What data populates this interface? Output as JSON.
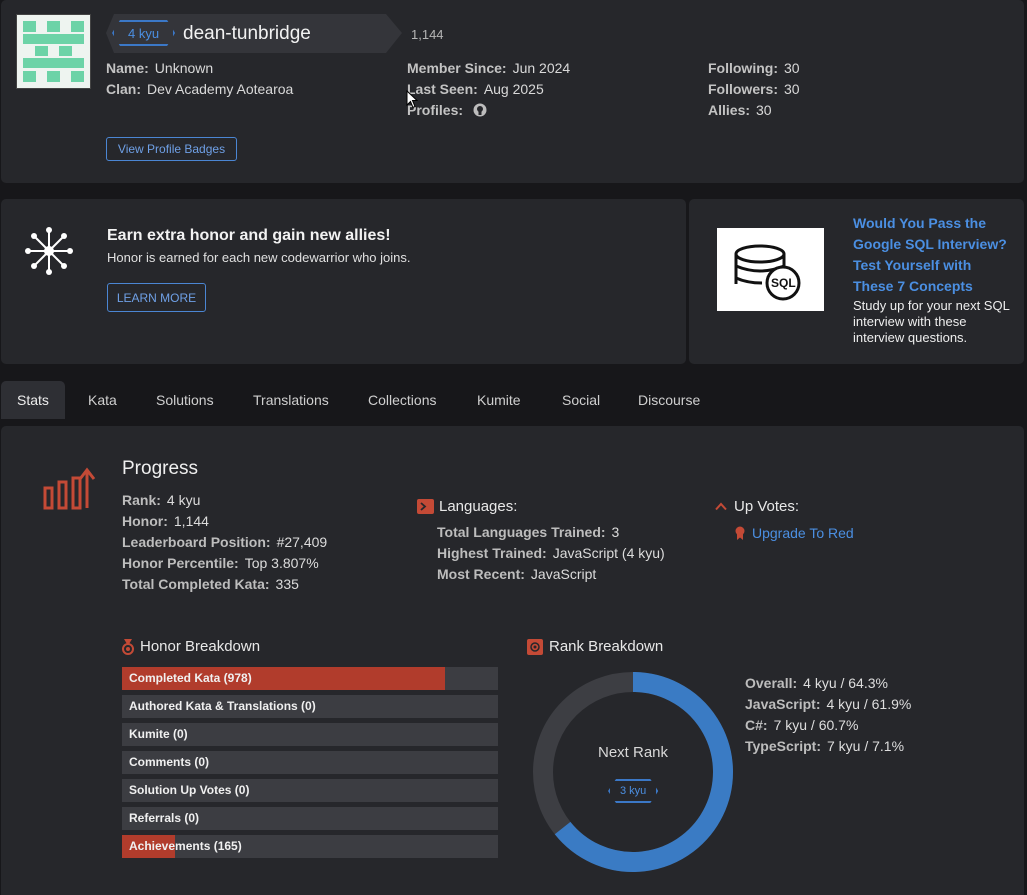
{
  "profile": {
    "rank": "4 kyu",
    "username": "dean-tunbridge",
    "honor": "1,144",
    "name_label": "Name:",
    "name": "Unknown",
    "clan_label": "Clan:",
    "clan": "Dev Academy Aotearoa",
    "member_since_label": "Member Since:",
    "member_since": "Jun 2024",
    "last_seen_label": "Last Seen:",
    "last_seen": "Aug 2025",
    "profiles_label": "Profiles:",
    "following_label": "Following:",
    "following": "30",
    "followers_label": "Followers:",
    "followers": "30",
    "allies_label": "Allies:",
    "allies": "30",
    "badges_button": "View Profile Badges"
  },
  "banner": {
    "title": "Earn extra honor and gain new allies!",
    "subtitle": "Honor is earned for each new codewarrior who joins.",
    "button": "LEARN MORE"
  },
  "ad": {
    "image_text": "SQL",
    "title": "Would You Pass the Google SQL Interview? Test Yourself with These 7 Concepts",
    "text": "Study up for your next SQL interview with these interview questions."
  },
  "tabs": [
    "Stats",
    "Kata",
    "Solutions",
    "Translations",
    "Collections",
    "Kumite",
    "Social",
    "Discourse"
  ],
  "progress": {
    "title": "Progress",
    "rank_label": "Rank:",
    "rank": "4 kyu",
    "honor_label": "Honor:",
    "honor": "1,144",
    "leaderboard_label": "Leaderboard Position:",
    "leaderboard": "#27,409",
    "percentile_label": "Honor Percentile:",
    "percentile": "Top 3.807%",
    "completed_label": "Total Completed Kata:",
    "completed": "335"
  },
  "languages": {
    "title": "Languages:",
    "trained_label": "Total Languages Trained:",
    "trained": "3",
    "highest_label": "Highest Trained:",
    "highest": "JavaScript (4 kyu)",
    "recent_label": "Most Recent:",
    "recent": "JavaScript"
  },
  "upvotes": {
    "title": "Up Votes:",
    "link": "Upgrade To Red"
  },
  "honor_breakdown": {
    "title": "Honor Breakdown",
    "rows": [
      {
        "label": "Completed Kata (978)",
        "fill": 0.86
      },
      {
        "label": "Authored Kata & Translations (0)",
        "fill": 0
      },
      {
        "label": "Kumite (0)",
        "fill": 0
      },
      {
        "label": "Comments (0)",
        "fill": 0
      },
      {
        "label": "Solution Up Votes (0)",
        "fill": 0
      },
      {
        "label": "Referrals (0)",
        "fill": 0
      },
      {
        "label": "Achievements (165)",
        "fill": 0.14
      }
    ]
  },
  "rank_breakdown": {
    "title": "Rank Breakdown",
    "center_text": "Next Rank",
    "next_rank": "3 kyu",
    "progress_fraction": 0.643,
    "colors": {
      "fill": "#3a7bc4",
      "track": "#3d3e43"
    },
    "overall_label": "Overall:",
    "overall": "4 kyu / 64.3%",
    "js_label": "JavaScript:",
    "js": "4 kyu / 61.9%",
    "cs_label": "C#:",
    "cs": "7 kyu / 60.7%",
    "ts_label": "TypeScript:",
    "ts": "7 kyu / 7.1%"
  },
  "colors": {
    "accent_blue": "#4b8fe2",
    "accent_red": "#c44a36",
    "panel": "#26272b"
  }
}
